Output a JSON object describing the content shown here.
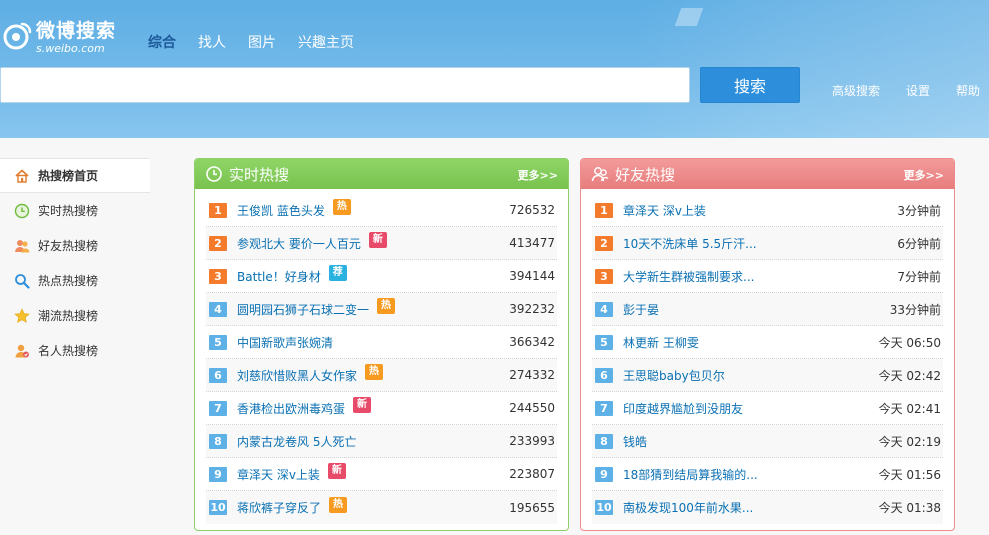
{
  "header": {
    "logo_title": "微博搜索",
    "logo_sub": "s.weibo.com",
    "nav": [
      {
        "label": "综合",
        "active": true
      },
      {
        "label": "找人",
        "active": false
      },
      {
        "label": "图片",
        "active": false
      },
      {
        "label": "兴趣主页",
        "active": false
      }
    ],
    "search_value": "",
    "search_button": "搜索",
    "links": [
      "高级搜索",
      "设置",
      "帮助"
    ]
  },
  "sidebar": {
    "items": [
      {
        "label": "热搜榜首页",
        "icon": "home-icon",
        "active": true
      },
      {
        "label": "实时热搜榜",
        "icon": "clock-icon",
        "active": false
      },
      {
        "label": "好友热搜榜",
        "icon": "friends-icon",
        "active": false
      },
      {
        "label": "热点热搜榜",
        "icon": "search-icon",
        "active": false
      },
      {
        "label": "潮流热搜榜",
        "icon": "star-icon",
        "active": false
      },
      {
        "label": "名人热搜榜",
        "icon": "celebrity-icon",
        "active": false
      }
    ]
  },
  "realtime": {
    "title": "实时热搜",
    "more": "更多>>",
    "rows": [
      {
        "rank": "1",
        "title": "王俊凯 蓝色头发",
        "tag": "热",
        "tag_type": "hot",
        "value": "726532"
      },
      {
        "rank": "2",
        "title": "参观北大 要价一人百元",
        "tag": "新",
        "tag_type": "new",
        "value": "413477"
      },
      {
        "rank": "3",
        "title": "Battle！好身材",
        "tag": "荐",
        "tag_type": "rec",
        "value": "394144"
      },
      {
        "rank": "4",
        "title": "圆明园石狮子石球二变一",
        "tag": "热",
        "tag_type": "hot",
        "value": "392232"
      },
      {
        "rank": "5",
        "title": "中国新歌声张婉清",
        "tag": "",
        "tag_type": "",
        "value": "366342"
      },
      {
        "rank": "6",
        "title": "刘慈欣惜败黑人女作家",
        "tag": "热",
        "tag_type": "hot",
        "value": "274332"
      },
      {
        "rank": "7",
        "title": "香港检出欧洲毒鸡蛋",
        "tag": "新",
        "tag_type": "new",
        "value": "244550"
      },
      {
        "rank": "8",
        "title": "内蒙古龙卷风 5人死亡",
        "tag": "",
        "tag_type": "",
        "value": "233993"
      },
      {
        "rank": "9",
        "title": "章泽天 深v上装",
        "tag": "新",
        "tag_type": "new",
        "value": "223807"
      },
      {
        "rank": "10",
        "title": "蒋欣裤子穿反了",
        "tag": "热",
        "tag_type": "hot",
        "value": "195655"
      }
    ]
  },
  "friends": {
    "title": "好友热搜",
    "more": "更多>>",
    "rows": [
      {
        "rank": "1",
        "title": "章泽天 深v上装",
        "value": "3分钟前"
      },
      {
        "rank": "2",
        "title": "10天不洗床单 5.5斤汗...",
        "value": "6分钟前"
      },
      {
        "rank": "3",
        "title": "大学新生群被强制要求...",
        "value": "7分钟前"
      },
      {
        "rank": "4",
        "title": "彭于晏",
        "value": "33分钟前"
      },
      {
        "rank": "5",
        "title": "林更新 王柳雯",
        "value": "今天 06:50"
      },
      {
        "rank": "6",
        "title": "王思聪baby包贝尔",
        "value": "今天 02:42"
      },
      {
        "rank": "7",
        "title": "印度越界尴尬到没朋友",
        "value": "今天 02:41"
      },
      {
        "rank": "8",
        "title": "钱皓",
        "value": "今天 02:19"
      },
      {
        "rank": "9",
        "title": "18部猜到结局算我输的...",
        "value": "今天 01:56"
      },
      {
        "rank": "10",
        "title": "南极发现100年前水果...",
        "value": "今天 01:38"
      }
    ]
  },
  "colors": {
    "header_blue": "#6cb6e8",
    "rank_top": "#f47b2c",
    "rank_norm": "#5eb1e6",
    "link": "#0a70b3",
    "green_panel": "#79c24f",
    "red_panel": "#e77d7d"
  }
}
